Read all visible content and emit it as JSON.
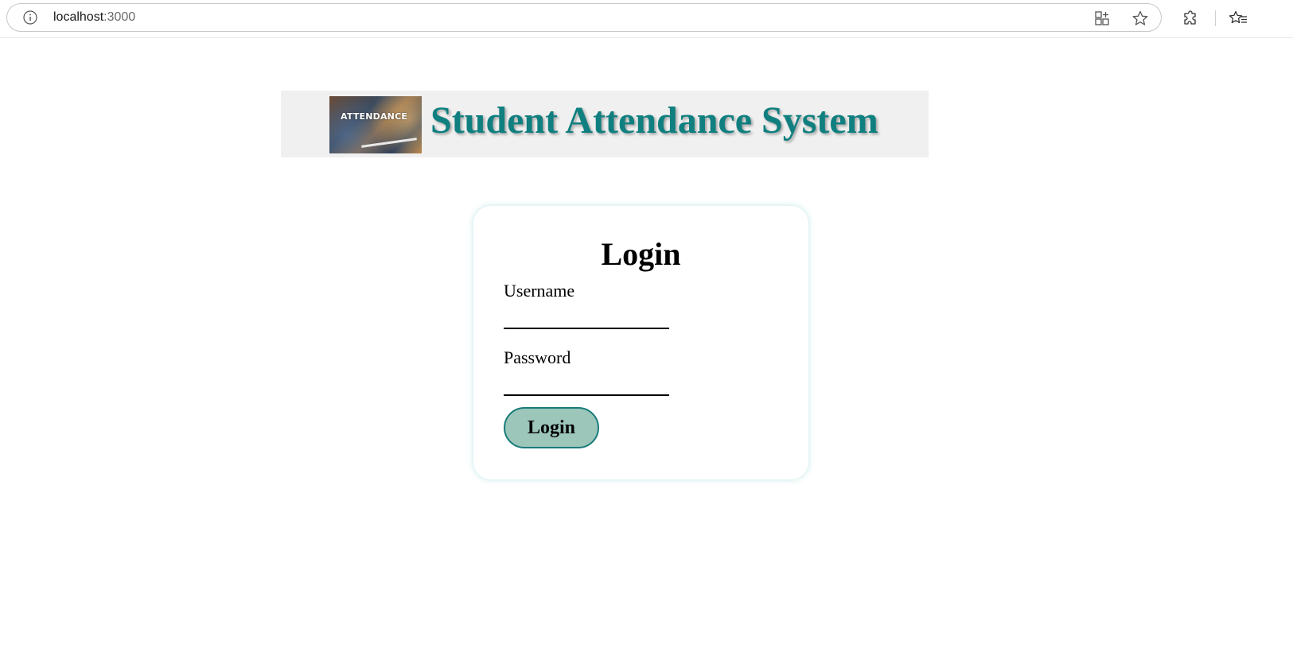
{
  "browser": {
    "url_host": "localhost",
    "url_port": ":3000",
    "icons": [
      "info-icon",
      "app-grid-icon",
      "star-icon",
      "extensions-icon",
      "favorites-icon"
    ]
  },
  "header": {
    "logo_text": "ATTENDANCE",
    "title": "Student Attendance System",
    "title_color": "#0f7f7f",
    "background": "#f0f0f0"
  },
  "login": {
    "heading": "Login",
    "username_label": "Username",
    "username_value": "",
    "password_label": "Password",
    "password_value": "",
    "button_label": "Login",
    "button_color": "#9cc6ba",
    "button_border": "#1a7a7a"
  }
}
